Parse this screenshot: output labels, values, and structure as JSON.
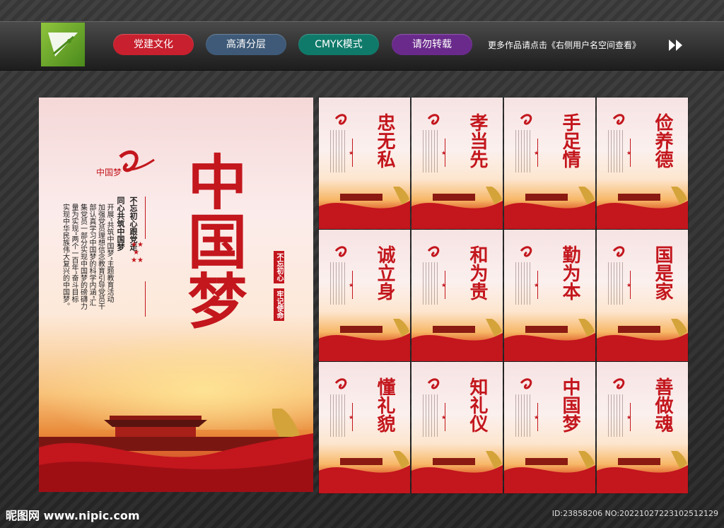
{
  "header": {
    "tags": [
      "党建文化",
      "高清分层",
      "CMYK模式",
      "请勿转载"
    ],
    "note": "更多作品请点击《右侧用户名空间查看》"
  },
  "main_poster": {
    "title": "中国梦",
    "logo_text": "中国梦",
    "paragraph": "开展“共筑中国梦”主题教育活动加强党员理想信念教育引导党员干部认真学习中国梦的科学内涵“汇集党员一部分实现中国梦的磅礴力量为实现“两个一百年”奋斗目标实现中华民族伟大复兴的中国梦。",
    "slogan_1": "不忘初心跟党走",
    "slogan_2": "同心共筑中国梦",
    "seal_1": "不忘初心",
    "seal_2": "牢记使命"
  },
  "cards": [
    {
      "title": "忠无私"
    },
    {
      "title": "孝当先"
    },
    {
      "title": "手足情"
    },
    {
      "title": "俭养德"
    },
    {
      "title": "诚立身"
    },
    {
      "title": "和为贵"
    },
    {
      "title": "勤为本"
    },
    {
      "title": "国是家"
    },
    {
      "title": "懂礼貌"
    },
    {
      "title": "知礼仪"
    },
    {
      "title": "中国梦"
    },
    {
      "title": "善做魂"
    }
  ],
  "footer": {
    "brand": "昵图网 www.nipic.com",
    "id": "ID:23858206 NO:20221027223102512129"
  },
  "colors": {
    "accent": "#c3161d",
    "tag1": "#c8202e",
    "tag2": "#3e5a78",
    "tag3": "#0f7a6a",
    "tag4": "#6a2a8c"
  }
}
